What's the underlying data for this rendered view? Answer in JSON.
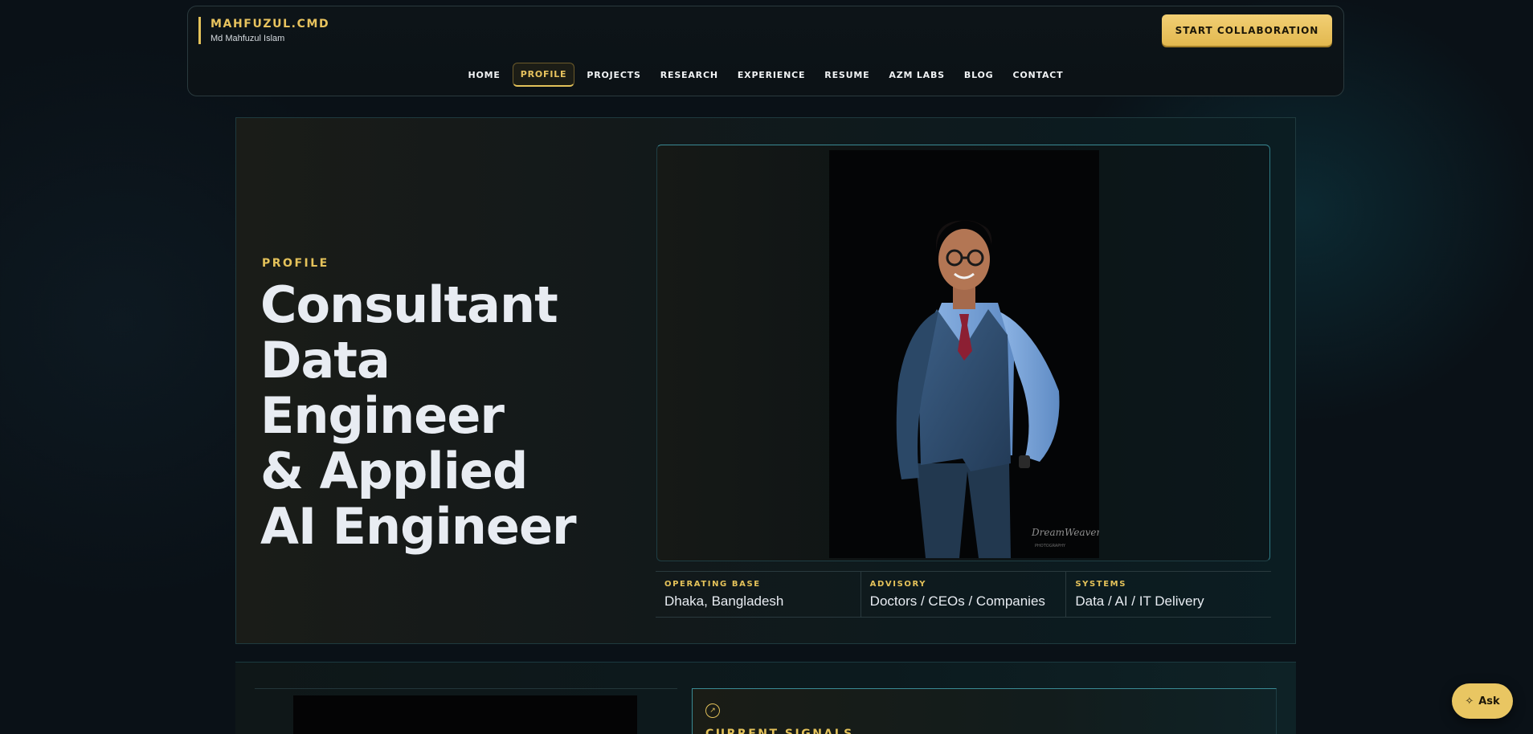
{
  "header": {
    "brand_title": "MAHFUZUL.CMD",
    "brand_subtitle": "Md Mahfuzul Islam",
    "cta_label": "START COLLABORATION",
    "nav": [
      {
        "label": "HOME"
      },
      {
        "label": "PROFILE",
        "active": true
      },
      {
        "label": "PROJECTS"
      },
      {
        "label": "RESEARCH"
      },
      {
        "label": "EXPERIENCE"
      },
      {
        "label": "RESUME"
      },
      {
        "label": "AZM LABS"
      },
      {
        "label": "BLOG"
      },
      {
        "label": "CONTACT"
      }
    ]
  },
  "hero": {
    "eyebrow": "PROFILE",
    "headline_line1": "Consultant",
    "headline_line2": "Data Engineer",
    "headline_line3": "& Applied",
    "headline_line4": "AI Engineer",
    "stats": [
      {
        "label": "OPERATING BASE",
        "value": "Dhaka, Bangladesh"
      },
      {
        "label": "ADVISORY",
        "value": "Doctors / CEOs / Companies"
      },
      {
        "label": "SYSTEMS",
        "value": "Data / AI / IT Delivery"
      }
    ]
  },
  "lower": {
    "signal_title": "CURRENT SIGNALS"
  },
  "ask_button": {
    "label": "Ask",
    "icon": "sparkle-icon"
  },
  "colors": {
    "accent": "#e4c25a",
    "background": "#0a1117",
    "teal": "#3a8a94"
  }
}
